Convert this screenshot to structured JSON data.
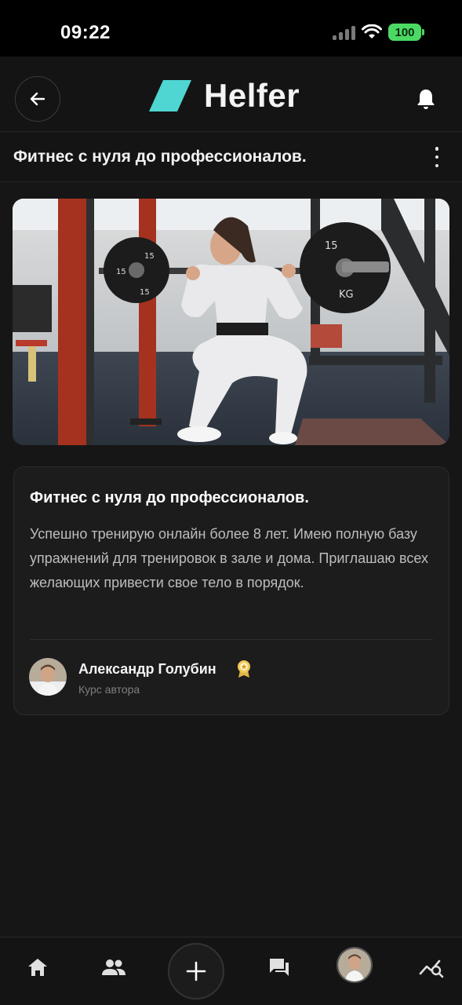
{
  "status_bar": {
    "time": "09:22",
    "battery": "100"
  },
  "header": {
    "logo_text": "Helfer",
    "brand_color": "#4fd6d2"
  },
  "page": {
    "title": "Фитнес с нуля до профессионалов."
  },
  "course": {
    "title": "Фитнес с нуля до профессионалов.",
    "description": "Успешно тренирую онлайн более 8 лет. Имею полную базу упражнений для тренировок в зале и дома. Приглашаю всех желающих привести свое тело в порядок.",
    "author_name": "Александр Голубин",
    "author_subtitle": "Курс автора"
  },
  "nav": {
    "items": [
      "home-icon",
      "people-icon",
      "add-icon",
      "chat-icon",
      "profile-avatar",
      "analytics-search-icon"
    ]
  },
  "plate_labels": {
    "left_a": "15",
    "left_b": "15",
    "left_c": "15",
    "right_a": "15",
    "right_b": "KG"
  }
}
